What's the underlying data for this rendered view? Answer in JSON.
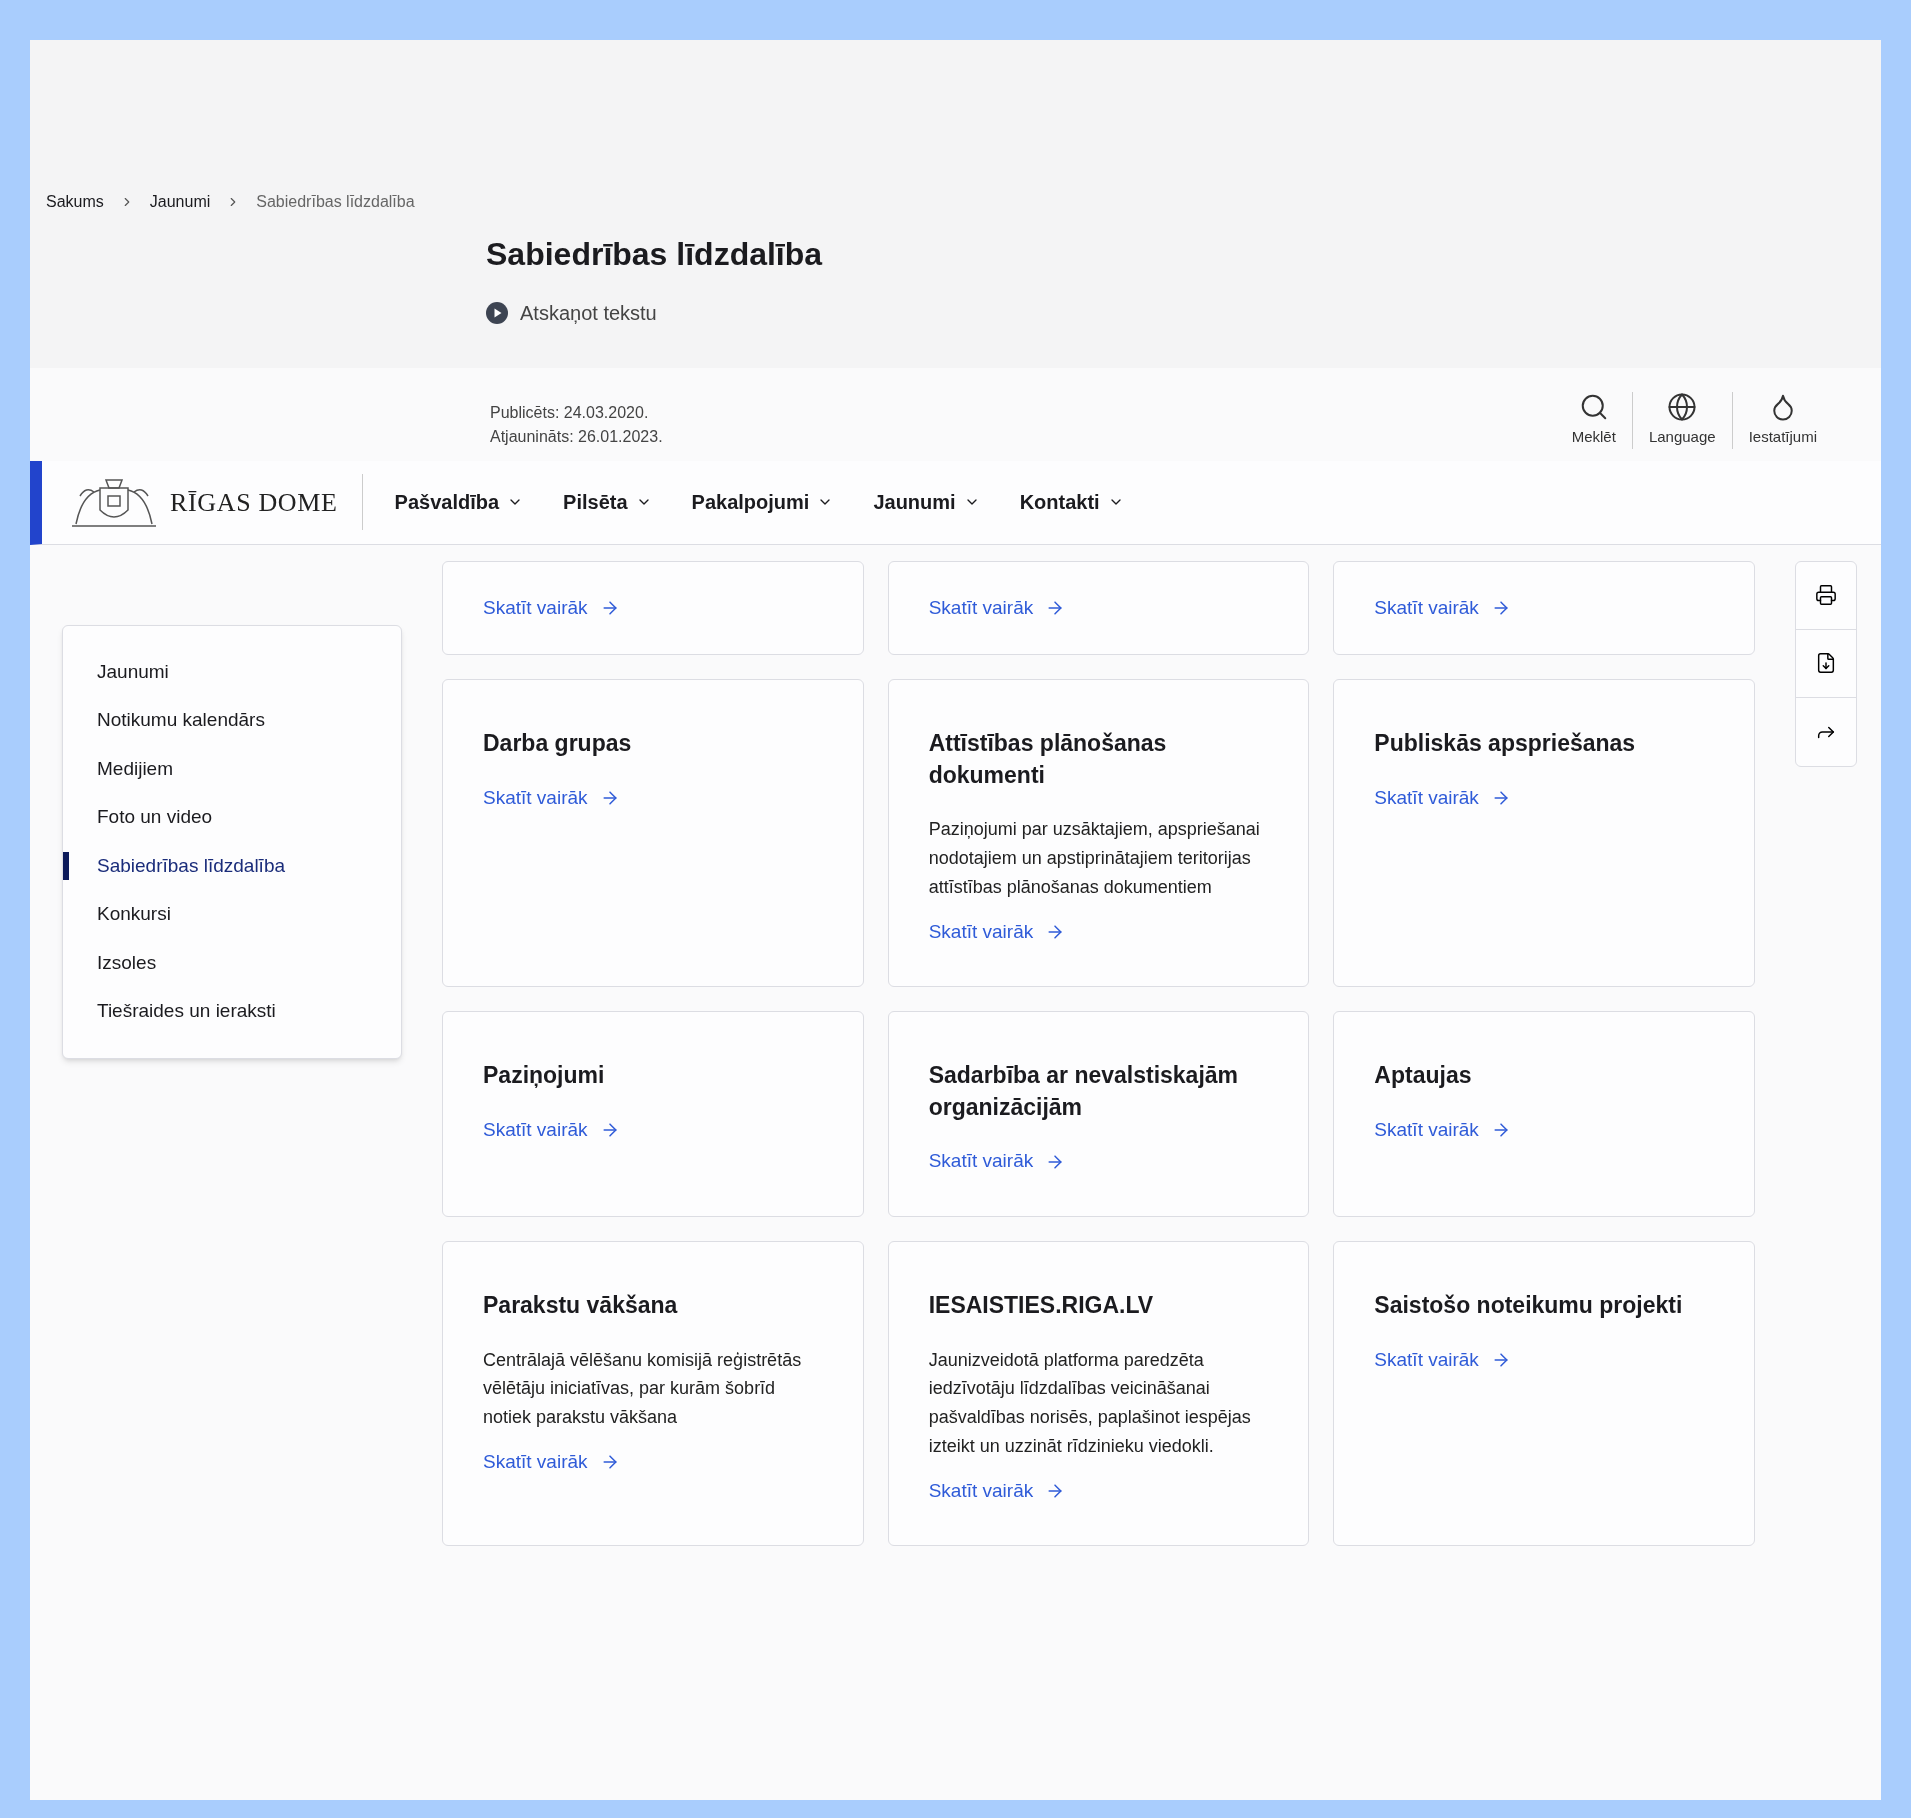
{
  "breadcrumbs": [
    {
      "label": "Sakums",
      "current": false
    },
    {
      "label": "Jaunumi",
      "current": false
    },
    {
      "label": "Sabiedrības līdzdalība",
      "current": true
    }
  ],
  "page_title": "Sabiedrības līdzdalība",
  "play_button": {
    "label": "Atskaņot tekstu"
  },
  "dates": [
    "Publicēts: 24.03.2020.",
    "Atjaunināts: 26.01.2023."
  ],
  "utility": [
    {
      "label": "Meklēt"
    },
    {
      "label": "Language"
    },
    {
      "label": "Iestatījumi"
    }
  ],
  "header": {
    "logo_text": "RĪGAS DOME",
    "nav": [
      "Pašvaldība",
      "Pilsēta",
      "Pakalpojumi",
      "Jaunumi",
      "Kontakti"
    ]
  },
  "sidebar": {
    "items": [
      {
        "label": "Jaunumi",
        "selected": false
      },
      {
        "label": "Notikumu kalendārs",
        "selected": false
      },
      {
        "label": "Medijiem",
        "selected": false
      },
      {
        "label": "Foto un video",
        "selected": false
      },
      {
        "label": "Sabiedrības līdzdalība",
        "selected": true
      },
      {
        "label": "Konkursi",
        "selected": false
      },
      {
        "label": "Izsoles",
        "selected": false
      },
      {
        "label": "Tiešraides un ieraksti",
        "selected": false
      }
    ]
  },
  "cards": [
    {
      "link": "Skatīt vairāk"
    },
    {
      "link": "Skatīt vairāk"
    },
    {
      "link": "Skatīt vairāk"
    },
    {
      "title": "Darba grupas",
      "link": "Skatīt vairāk"
    },
    {
      "title": "Attīstības plānošanas dokumenti",
      "description": "Paziņojumi par uzsāktajiem, apspriešanai nodotajiem un apstiprinātajiem teritorijas attīstības plānošanas dokumentiem",
      "link": "Skatīt vairāk"
    },
    {
      "title": "Publiskās apspriešanas",
      "link": "Skatīt vairāk"
    },
    {
      "title": "Paziņojumi",
      "link": "Skatīt vairāk"
    },
    {
      "title": "Sadarbība ar nevalstiskajām organizācijām",
      "link": "Skatīt vairāk"
    },
    {
      "title": "Aptaujas",
      "link": "Skatīt vairāk"
    },
    {
      "title": "Parakstu vākšana",
      "description": "Centrālajā vēlēšanu komisijā reģistrētās vēlētāju iniciatīvas, par kurām šobrīd notiek parakstu vākšana",
      "link": "Skatīt vairāk"
    },
    {
      "title": "IESAISTIES.RIGA.LV",
      "description": "Jaunizveidotā platforma paredzēta iedzīvotāju līdzdalības veicināšanai pašvaldības norisēs, paplašinot iespējas izteikt un uzzināt rīdzinieku viedokli.",
      "link": "Skatīt vairāk"
    },
    {
      "title": "Saistošo noteikumu projekti",
      "link": "Skatīt vairāk"
    }
  ]
}
